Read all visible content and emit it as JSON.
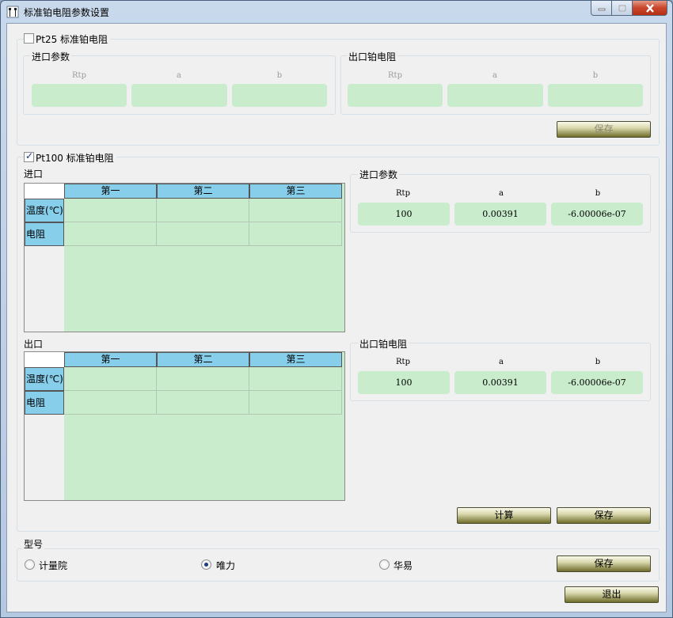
{
  "window": {
    "title": "标准铂电阻参数设置"
  },
  "pt25": {
    "label": "Pt25 标准铂电阻",
    "checked": false,
    "inlet": {
      "legend": "进口参数",
      "headers": [
        "Rtp",
        "a",
        "b"
      ],
      "values": [
        "",
        "",
        ""
      ]
    },
    "outlet": {
      "legend": "出口铂电阻",
      "headers": [
        "Rtp",
        "a",
        "b"
      ],
      "values": [
        "",
        "",
        ""
      ]
    },
    "save_label": "保存"
  },
  "pt100": {
    "label": "Pt100 标准铂电阻",
    "checked": true,
    "inlet_table": {
      "title": "进口",
      "columns": [
        "第一",
        "第二",
        "第三"
      ],
      "rows": [
        "温度(℃)",
        "电阻"
      ]
    },
    "outlet_table": {
      "title": "出口",
      "columns": [
        "第一",
        "第二",
        "第三"
      ],
      "rows": [
        "温度(℃)",
        "电阻"
      ]
    },
    "inlet_params": {
      "legend": "进口参数",
      "headers": [
        "Rtp",
        "a",
        "b"
      ],
      "values": [
        "100",
        "0.00391",
        "-6.00006e-07"
      ]
    },
    "outlet_params": {
      "legend": "出口铂电阻",
      "headers": [
        "Rtp",
        "a",
        "b"
      ],
      "values": [
        "100",
        "0.00391",
        "-6.00006e-07"
      ]
    },
    "calc_label": "计算",
    "save_label": "保存"
  },
  "model": {
    "legend": "型号",
    "options": [
      "计量院",
      "唯力",
      "华易"
    ],
    "selected": "唯力",
    "save_label": "保存"
  },
  "exit_label": "退出"
}
